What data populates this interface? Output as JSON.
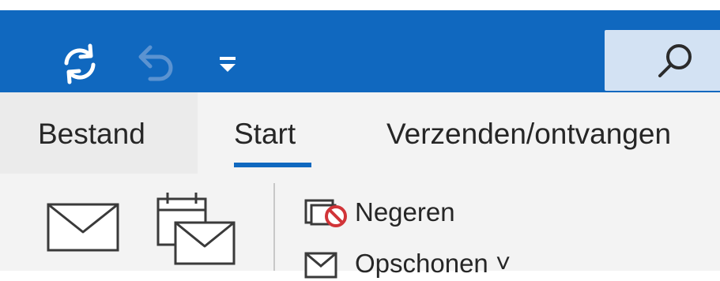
{
  "colors": {
    "title_bar": "#1068bf",
    "accent": "#1068bf",
    "tab_bar": "#f3f3f3",
    "search_box": "#d3e2f3"
  },
  "quick_access": {
    "sync_icon": "sync-icon",
    "undo_icon": "undo-icon",
    "customize_icon": "customize-quick-access-icon"
  },
  "search": {
    "icon": "search-icon"
  },
  "tabs": [
    {
      "label": "Bestand",
      "selected": false
    },
    {
      "label": "Start",
      "selected": true
    },
    {
      "label": "Verzenden/ontvangen",
      "selected": false
    }
  ],
  "ribbon": {
    "new_mail_icon": "new-mail-icon",
    "new_items_icon": "new-items-icon",
    "commands": [
      {
        "label": "Negeren",
        "icon": "ignore-icon"
      },
      {
        "label": "Opschonen ˅",
        "icon": "clean-up-icon"
      }
    ]
  }
}
